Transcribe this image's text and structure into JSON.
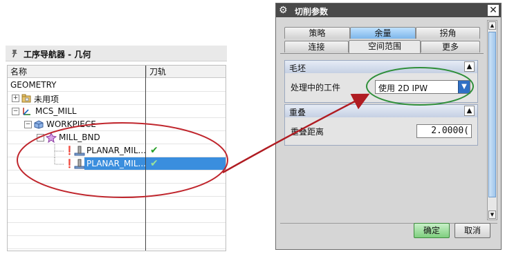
{
  "navigator": {
    "title": "工序导航器 - 几何",
    "columns": [
      "名称",
      "刀轨"
    ],
    "rows": [
      {
        "label": "GEOMETRY",
        "check": ""
      },
      {
        "label": "未用项",
        "check": ""
      },
      {
        "label": "MCS_MILL",
        "check": ""
      },
      {
        "label": "WORKPIECE",
        "check": ""
      },
      {
        "label": "MILL_BND",
        "check": ""
      },
      {
        "label": "PLANAR_MIL...",
        "check": "✔"
      },
      {
        "label": "PLANAR_MIL...",
        "check": "✔"
      }
    ]
  },
  "dialog": {
    "title": "切削参数",
    "close": "✕",
    "tabs_row1": [
      "策略",
      "余量",
      "拐角"
    ],
    "tabs_row2": [
      "连接",
      "空间范围",
      "更多"
    ],
    "group_blank": {
      "header": "毛坯",
      "field_label": "处理中的工件",
      "field_value": "使用 2D IPW"
    },
    "group_overlap": {
      "header": "重叠",
      "field_label": "重叠距离",
      "field_value": "2.0000("
    },
    "ok": "确定",
    "cancel": "取消"
  },
  "colors": {
    "selection": "#3a8ede",
    "ellipse_red": "#c0262d",
    "ellipse_green": "#2f8f3a",
    "arrow": "#b01c22"
  }
}
